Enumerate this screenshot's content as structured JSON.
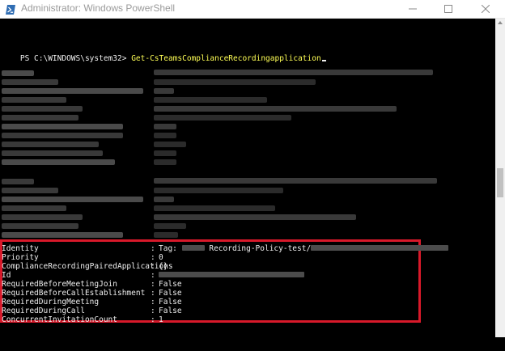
{
  "window": {
    "title": "Administrator: Windows PowerShell",
    "icon": "powershell-icon",
    "controls": [
      "minimize-icon",
      "maximize-icon",
      "close-icon"
    ]
  },
  "console": {
    "prompt": "PS C:\\WINDOWS\\system32>",
    "command": "Get-CsTeamsComplianceRecordingapplication",
    "separator": ":",
    "properties": [
      {
        "name": "Identity",
        "value": "Tag:",
        "value_after": "Recording-Policy-test/"
      },
      {
        "name": "Priority",
        "value": "0"
      },
      {
        "name": "ComplianceRecordingPairedApplications",
        "value": "{}"
      },
      {
        "name": "Id",
        "value": ""
      },
      {
        "name": "RequiredBeforeMeetingJoin",
        "value": "False"
      },
      {
        "name": "RequiredBeforeCallEstablishment",
        "value": "False"
      },
      {
        "name": "RequiredDuringMeeting",
        "value": "False"
      },
      {
        "name": "RequiredDuringCall",
        "value": "False"
      },
      {
        "name": "ConcurrentInvitationCount",
        "value": "1"
      }
    ]
  },
  "colors": {
    "background": "#000000",
    "text": "#eeeeee",
    "command": "#ffff55",
    "highlight_border": "#d8192a"
  }
}
